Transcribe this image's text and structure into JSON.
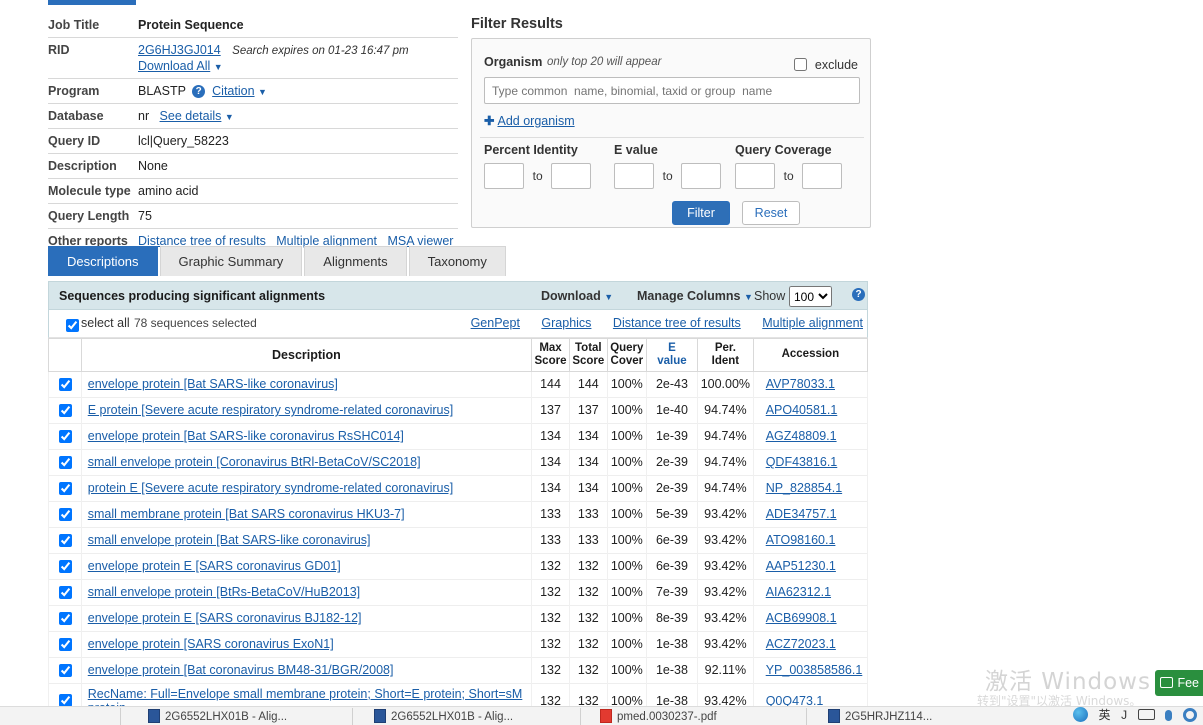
{
  "job_info": {
    "rows": [
      {
        "label": "Job Title",
        "value": "Protein Sequence"
      },
      {
        "label": "RID",
        "value": "2G6HJ3GJ014",
        "note": "Search expires on 01-23 16:47 pm",
        "download_all": "Download All"
      },
      {
        "label": "Program",
        "value": "BLASTP",
        "link": "Citation"
      },
      {
        "label": "Database",
        "value": "nr",
        "link": "See details"
      },
      {
        "label": "Query ID",
        "value": "lcl|Query_58223"
      },
      {
        "label": "Description",
        "value": "None"
      },
      {
        "label": "Molecule type",
        "value": "amino acid"
      },
      {
        "label": "Query Length",
        "value": "75"
      },
      {
        "label": "Other reports",
        "links": [
          "Distance tree of results",
          "Multiple alignment",
          "MSA viewer"
        ]
      }
    ]
  },
  "filter": {
    "title": "Filter Results",
    "organism_label": "Organism",
    "organism_note": "only top 20 will appear",
    "exclude_label": "exclude",
    "organism_placeholder": "Type common  name, binomial, taxid or group  name",
    "add_organism": "Add organism",
    "percent_identity_label": "Percent Identity",
    "evalue_label": "E value",
    "query_coverage_label": "Query Coverage",
    "to_label": "to",
    "filter_button": "Filter",
    "reset_button": "Reset",
    "pi_from": "",
    "pi_to": "",
    "ev_from": "",
    "ev_to": "",
    "qc_from": "",
    "qc_to": ""
  },
  "tabs": [
    {
      "label": "Descriptions",
      "active": true
    },
    {
      "label": "Graphic Summary",
      "active": false
    },
    {
      "label": "Alignments",
      "active": false
    },
    {
      "label": "Taxonomy",
      "active": false
    }
  ],
  "results_header": {
    "title": "Sequences producing significant alignments",
    "download": "Download",
    "manage_columns": "Manage Columns",
    "show_label": "Show",
    "show_value": "100"
  },
  "select_bar": {
    "select_all": "select all",
    "count": "78 sequences selected",
    "links": [
      "GenPept",
      "Graphics",
      "Distance tree of results",
      "Multiple alignment"
    ]
  },
  "table": {
    "headers": {
      "description": "Description",
      "max_score": "Max\nScore",
      "total_score": "Total\nScore",
      "query_cover": "Query\nCover",
      "e_value": "E\nvalue",
      "per_ident": "Per.\nIdent",
      "accession": "Accession"
    },
    "rows": [
      {
        "desc": "envelope protein [Bat SARS-like coronavirus]",
        "max": "144",
        "total": "144",
        "qc": "100%",
        "ev": "2e-43",
        "pi": "100.00%",
        "acc": "AVP78033.1",
        "checked": true
      },
      {
        "desc": "E protein [Severe acute respiratory syndrome-related coronavirus]",
        "max": "137",
        "total": "137",
        "qc": "100%",
        "ev": "1e-40",
        "pi": "94.74%",
        "acc": "APO40581.1",
        "checked": true
      },
      {
        "desc": "envelope protein [Bat SARS-like coronavirus RsSHC014]",
        "max": "134",
        "total": "134",
        "qc": "100%",
        "ev": "1e-39",
        "pi": "94.74%",
        "acc": "AGZ48809.1",
        "checked": true
      },
      {
        "desc": "small envelope protein [Coronavirus BtRl-BetaCoV/SC2018]",
        "max": "134",
        "total": "134",
        "qc": "100%",
        "ev": "2e-39",
        "pi": "94.74%",
        "acc": "QDF43816.1",
        "checked": true
      },
      {
        "desc": "protein E [Severe acute respiratory syndrome-related coronavirus]",
        "max": "134",
        "total": "134",
        "qc": "100%",
        "ev": "2e-39",
        "pi": "94.74%",
        "acc": "NP_828854.1",
        "checked": true
      },
      {
        "desc": "small membrane protein [Bat SARS coronavirus HKU3-7]",
        "max": "133",
        "total": "133",
        "qc": "100%",
        "ev": "5e-39",
        "pi": "93.42%",
        "acc": "ADE34757.1",
        "checked": true
      },
      {
        "desc": "small envelope protein [Bat SARS-like coronavirus]",
        "max": "133",
        "total": "133",
        "qc": "100%",
        "ev": "6e-39",
        "pi": "93.42%",
        "acc": "ATO98160.1",
        "checked": true
      },
      {
        "desc": "envelope protein E [SARS coronavirus GD01]",
        "max": "132",
        "total": "132",
        "qc": "100%",
        "ev": "6e-39",
        "pi": "93.42%",
        "acc": "AAP51230.1",
        "checked": true
      },
      {
        "desc": "small envelope protein [BtRs-BetaCoV/HuB2013]",
        "max": "132",
        "total": "132",
        "qc": "100%",
        "ev": "7e-39",
        "pi": "93.42%",
        "acc": "AIA62312.1",
        "checked": true
      },
      {
        "desc": "envelope protein E [SARS coronavirus BJ182-12]",
        "max": "132",
        "total": "132",
        "qc": "100%",
        "ev": "8e-39",
        "pi": "93.42%",
        "acc": "ACB69908.1",
        "checked": true
      },
      {
        "desc": "envelope protein [SARS coronavirus ExoN1]",
        "max": "132",
        "total": "132",
        "qc": "100%",
        "ev": "1e-38",
        "pi": "93.42%",
        "acc": "ACZ72023.1",
        "checked": true
      },
      {
        "desc": "envelope protein [Bat coronavirus BM48-31/BGR/2008]",
        "max": "132",
        "total": "132",
        "qc": "100%",
        "ev": "1e-38",
        "pi": "92.11%",
        "acc": "YP_003858586.1",
        "checked": true
      },
      {
        "desc": "RecName: Full=Envelope small membrane protein; Short=E protein; Short=sM protein",
        "max": "132",
        "total": "132",
        "qc": "100%",
        "ev": "1e-38",
        "pi": "93.42%",
        "acc": "Q0Q473.1",
        "checked": true
      }
    ]
  },
  "watermark": {
    "line1": "激活 Windows",
    "line2": "转到\"设置\"以激活 Windows。"
  },
  "feedback": {
    "label": "Fee"
  },
  "taskbar": {
    "items": [
      {
        "label": "2G6552LHX01B - Alig...",
        "icon": "doc"
      },
      {
        "label": "2G6552LHX01B - Alig...",
        "icon": "doc"
      },
      {
        "label": "pmed.0030237-.pdf",
        "icon": "pdf"
      },
      {
        "label": "2G5HRJHZ114...",
        "icon": "doc"
      }
    ],
    "tray": {
      "ime": "英",
      "lang": "J"
    }
  }
}
